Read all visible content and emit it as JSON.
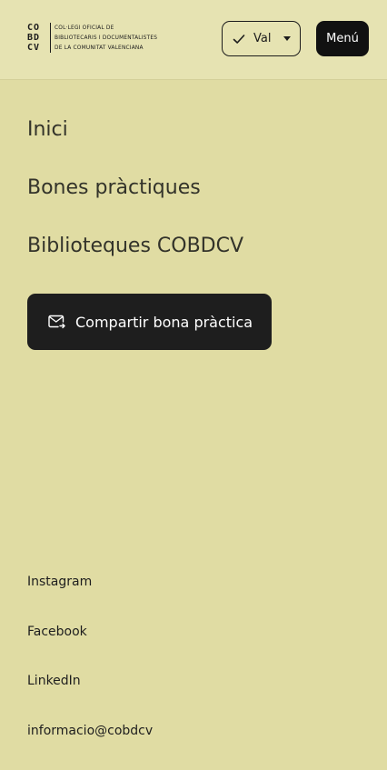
{
  "header": {
    "logo_mark": [
      "CO",
      "BD",
      "CV"
    ],
    "logo_text": [
      "COL·LEGI OFICIAL DE",
      "BIBLIOTECARIS I DOCUMENTALISTES",
      "DE LA COMUNITAT VALENCIANA"
    ],
    "language": {
      "selected": "Val",
      "icon": "check-icon"
    },
    "menu_label": "Menú"
  },
  "nav": {
    "items": [
      {
        "label": "Inici"
      },
      {
        "label": "Bones pràctiques"
      },
      {
        "label": "Biblioteques COBDCV"
      }
    ]
  },
  "share_button": {
    "label": "Compartir bona pràctica",
    "icon": "mail-icon"
  },
  "footer": {
    "links": [
      {
        "label": "Instagram"
      },
      {
        "label": "Facebook"
      },
      {
        "label": "LinkedIn"
      },
      {
        "label": "informacio@cobdcv"
      }
    ]
  },
  "colors": {
    "background": "#e0dca3",
    "header_background": "#e6e3b2",
    "button_dark": "#1e1e1e",
    "text": "#33332a"
  }
}
